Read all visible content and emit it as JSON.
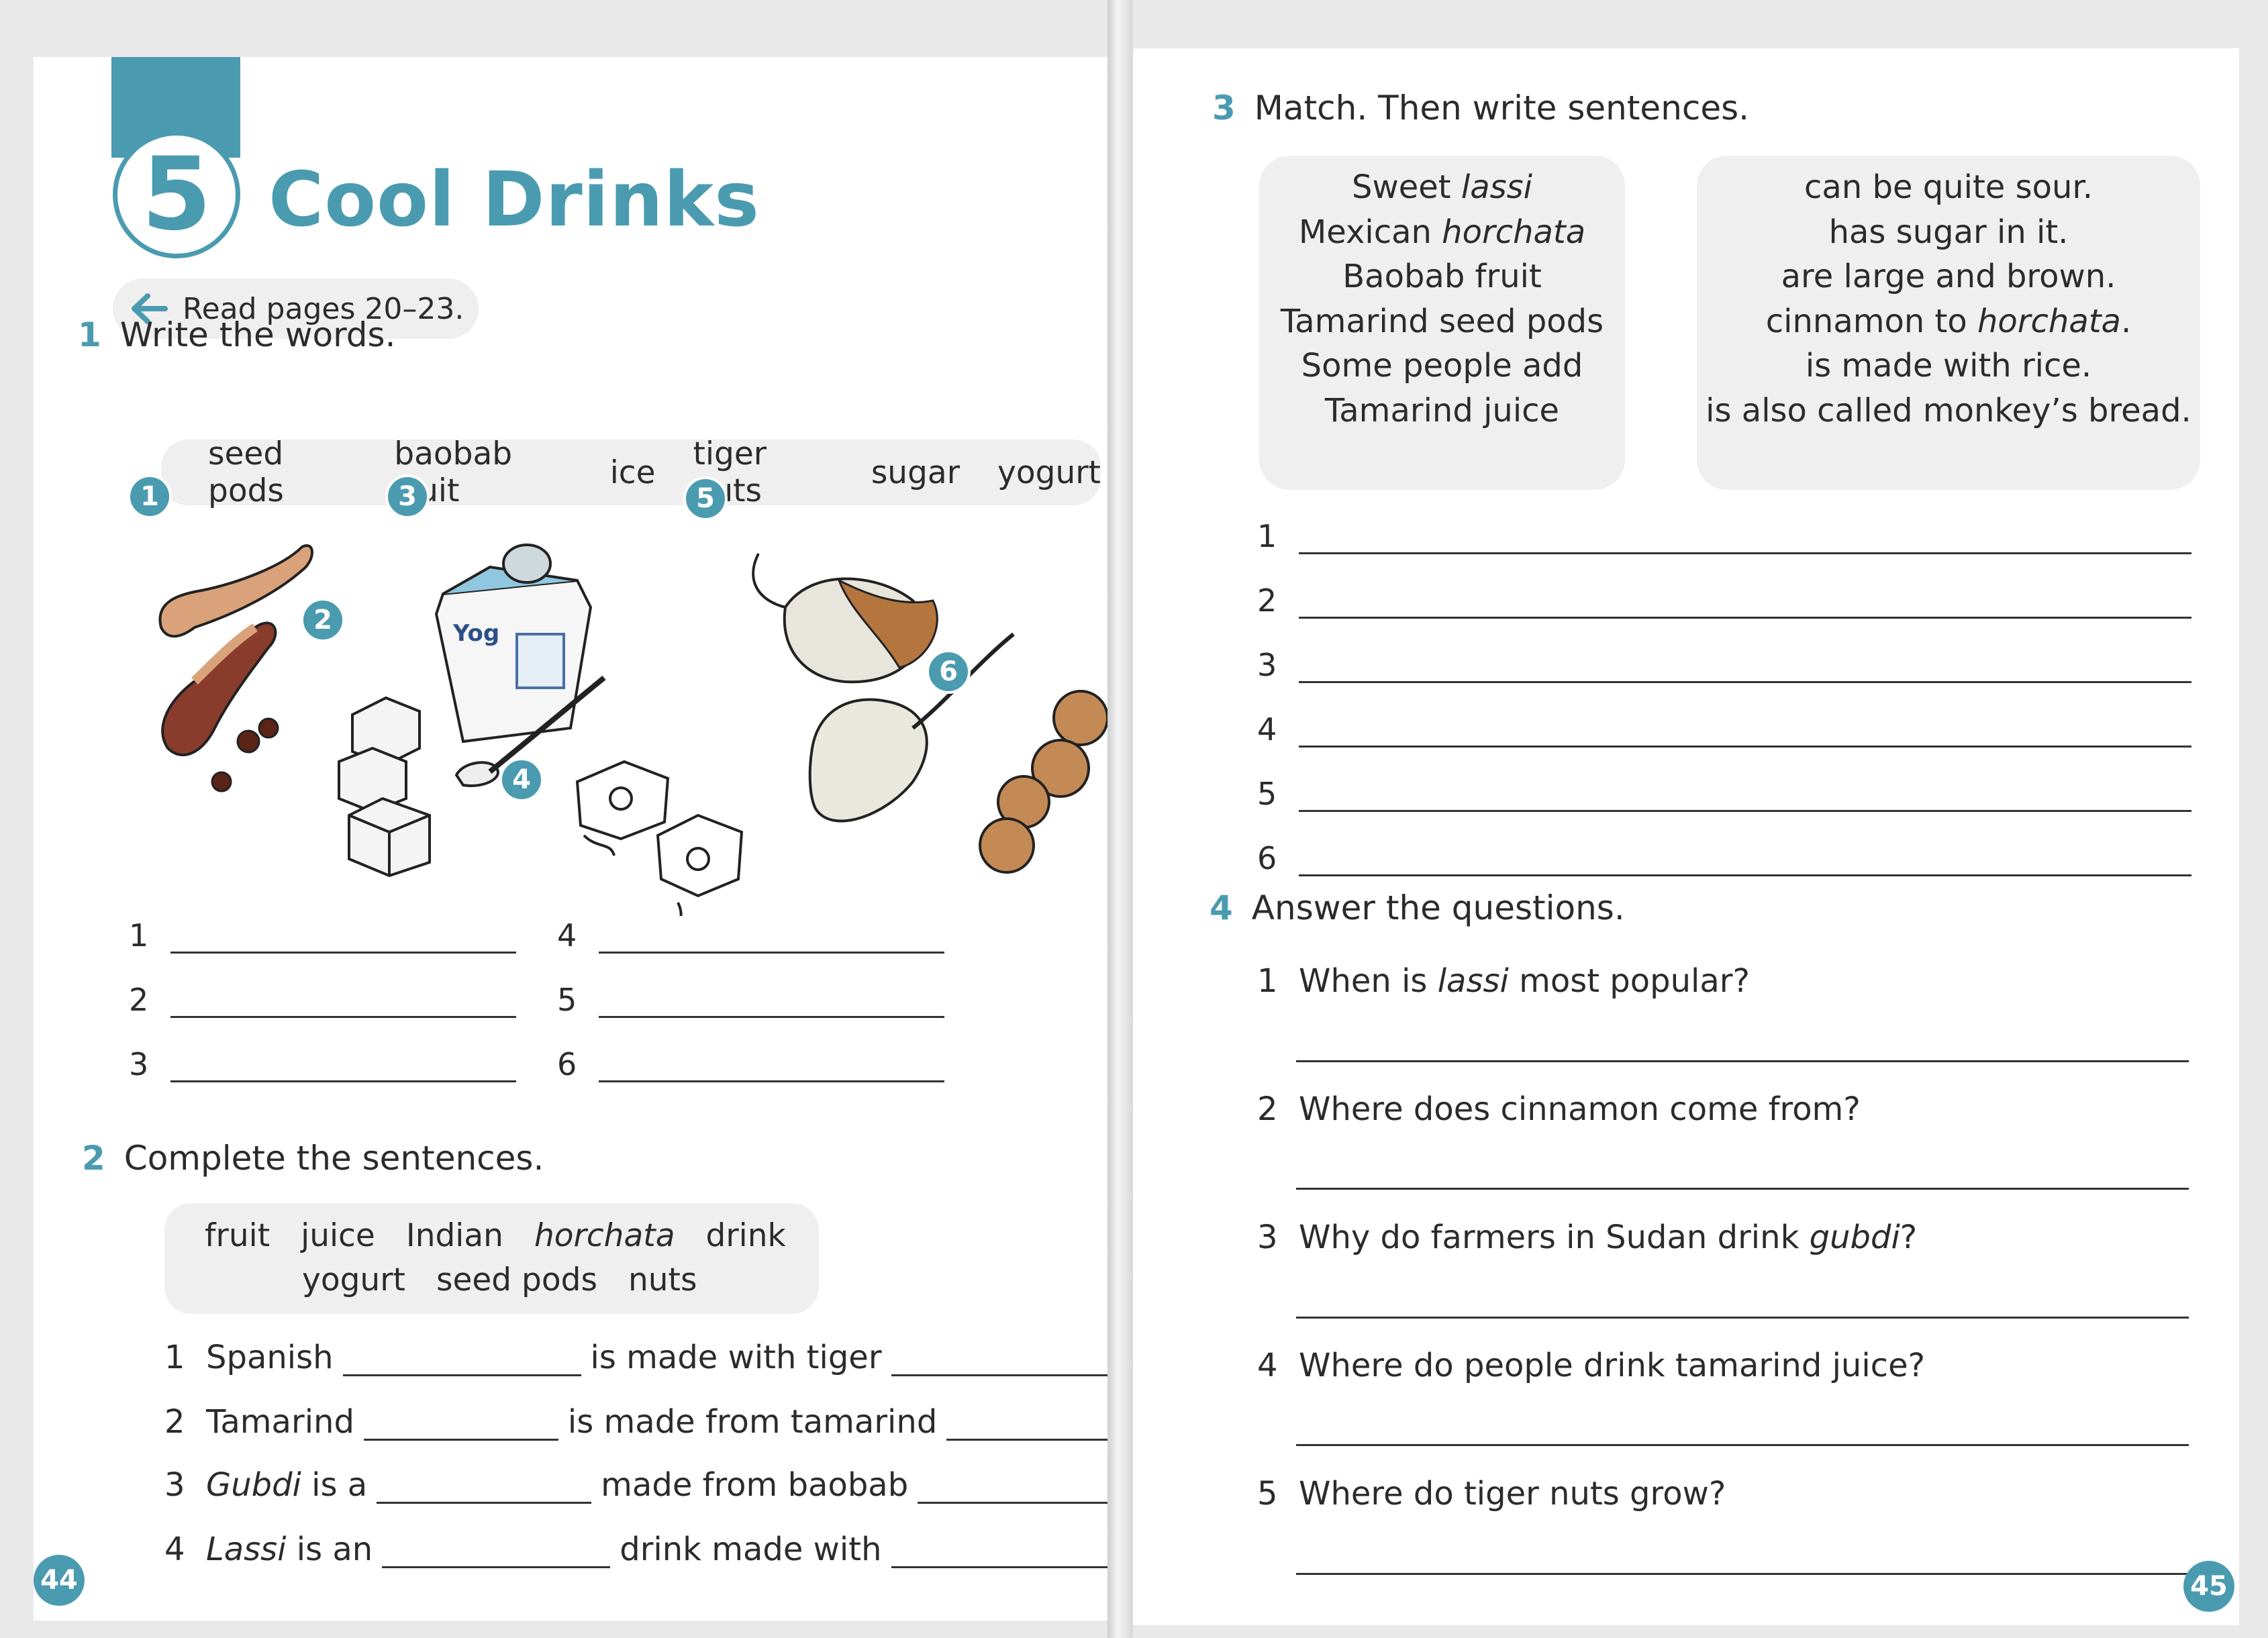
{
  "left_page": {
    "unit_number": "5",
    "title": "Cool Drinks",
    "read_pages": "Read pages 20–23.",
    "exercise1": {
      "number": "1",
      "heading": "Write the words.",
      "words": [
        "seed pods",
        "baobab fruit",
        "ice",
        "tiger nuts",
        "sugar",
        "yogurt"
      ],
      "picture_labels": [
        "1",
        "2",
        "3",
        "4",
        "5",
        "6"
      ],
      "yogurt_pot_text": "Yog",
      "answer_numbers": [
        "1",
        "2",
        "3",
        "4",
        "5",
        "6"
      ]
    },
    "exercise2": {
      "number": "2",
      "heading": "Complete the sentences.",
      "words_row1": [
        "fruit",
        "juice",
        "Indian",
        "horchata",
        "drink"
      ],
      "words_row2": [
        "yogurt",
        "seed pods",
        "nuts"
      ],
      "sentences": [
        {
          "n": "1",
          "a": "Spanish",
          "a_italic": "",
          "b": "is made with tiger",
          "end": "."
        },
        {
          "n": "2",
          "a": "Tamarind",
          "a_italic": "",
          "b": "is made from tamarind",
          "end": "."
        },
        {
          "n": "3",
          "a": "is a",
          "a_italic": "Gubdi",
          "b": "made from baobab",
          "end": "."
        },
        {
          "n": "4",
          "a": "is an",
          "a_italic": "Lassi",
          "b": "drink made with",
          "end": "."
        }
      ]
    },
    "page_number": "44"
  },
  "right_page": {
    "exercise3": {
      "number": "3",
      "heading": "Match. Then write sentences.",
      "left_items": [
        {
          "plain": "Sweet ",
          "italic": "lassi"
        },
        {
          "plain": "Mexican ",
          "italic": "horchata"
        },
        {
          "plain": "Baobab fruit",
          "italic": ""
        },
        {
          "plain": "Tamarind seed pods",
          "italic": ""
        },
        {
          "plain": "Some people add",
          "italic": ""
        },
        {
          "plain": "Tamarind juice",
          "italic": ""
        }
      ],
      "right_items": [
        {
          "plain": "can be quite sour.",
          "italic": "",
          "after": ""
        },
        {
          "plain": "has sugar in it.",
          "italic": "",
          "after": ""
        },
        {
          "plain": "are large and brown.",
          "italic": "",
          "after": ""
        },
        {
          "plain": "cinnamon to ",
          "italic": "horchata",
          "after": "."
        },
        {
          "plain": "is made with rice.",
          "italic": "",
          "after": ""
        },
        {
          "plain": "is also called monkey’s bread.",
          "italic": "",
          "after": ""
        }
      ],
      "line_numbers": [
        "1",
        "2",
        "3",
        "4",
        "5",
        "6"
      ]
    },
    "exercise4": {
      "number": "4",
      "heading": "Answer the questions.",
      "questions": [
        {
          "n": "1",
          "before": "When is ",
          "italic": "lassi",
          "after": " most popular?"
        },
        {
          "n": "2",
          "before": "Where does cinnamon come from?",
          "italic": "",
          "after": ""
        },
        {
          "n": "3",
          "before": "Why do farmers in Sudan drink ",
          "italic": "gubdi",
          "after": "?"
        },
        {
          "n": "4",
          "before": "Where do people drink tamarind juice?",
          "italic": "",
          "after": ""
        },
        {
          "n": "5",
          "before": "Where do tiger nuts grow?",
          "italic": "",
          "after": ""
        }
      ]
    },
    "page_number": "45"
  },
  "colors": {
    "accent": "#4a9bb0",
    "box_fill": "#efefef",
    "text": "#2b2b2b"
  }
}
